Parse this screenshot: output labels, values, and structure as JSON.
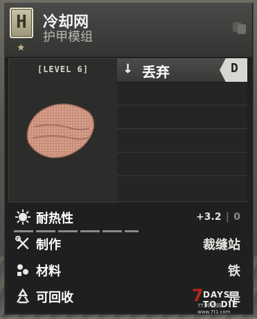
{
  "item": {
    "tier_letter": "H",
    "title": "冷却网",
    "subtitle": "护甲模组",
    "level_label": "[LEVEL 6]",
    "icon": "cooling-mesh-cloth"
  },
  "actions": {
    "discard_label": "丢弃",
    "discard_key": "D",
    "empty_slots": 5
  },
  "stats": [
    {
      "icon": "heat-icon",
      "name": "耐热性",
      "value": "+3.2",
      "alt": "0",
      "bar_segments": 5
    },
    {
      "icon": "tools-icon",
      "name": "制作",
      "value": "裁缝站"
    },
    {
      "icon": "materials-icon",
      "name": "材料",
      "value": "铁"
    },
    {
      "icon": "recycle-icon",
      "name": "可回收",
      "value": "是"
    }
  ],
  "watermark": {
    "brand": "DAYS TO DIE",
    "sub": "7T1中文网 www.7t1.com"
  }
}
